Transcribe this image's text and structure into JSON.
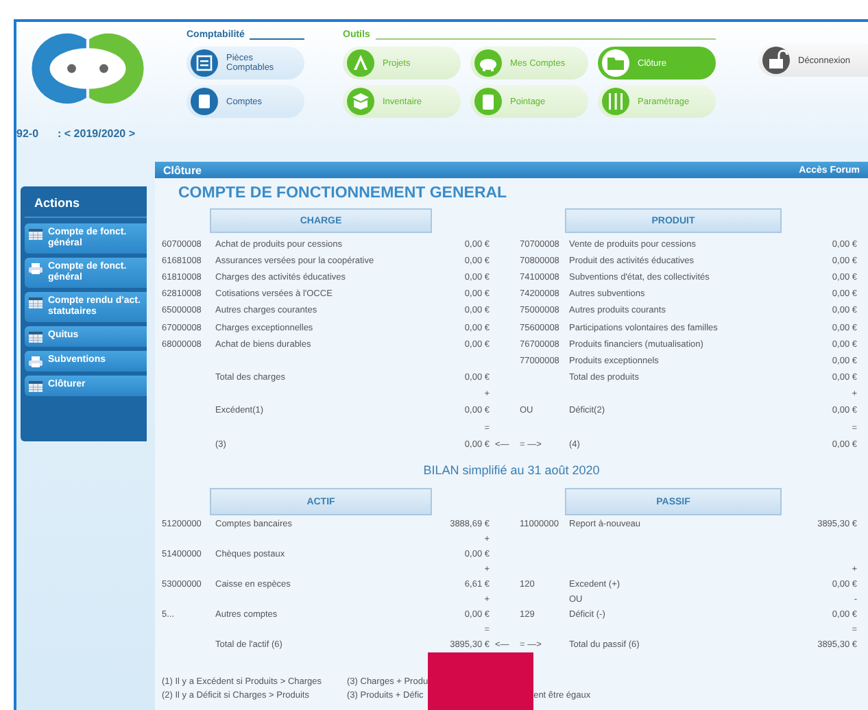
{
  "school": {
    "code": "92-0",
    "year": ": < 2019/2020 >"
  },
  "nav_groups": [
    {
      "title": "Comptabilité",
      "kind": "accounting",
      "items": [
        {
          "label": "Pièces Comptables",
          "selected": false
        },
        {
          "label": "Comptes",
          "selected": false
        }
      ]
    },
    {
      "title": "Outils",
      "kind": "tools",
      "items": [
        {
          "label": "Projets",
          "selected": false
        },
        {
          "label": "Mes Comptes",
          "selected": false
        },
        {
          "label": "Clôture",
          "selected": true
        },
        {
          "label": "Inventaire",
          "selected": false
        },
        {
          "label": "Pointage",
          "selected": false
        },
        {
          "label": "Paramètrage",
          "selected": false
        }
      ]
    }
  ],
  "logout_button": "Déconnexion",
  "sidebar": {
    "title": "Actions",
    "items": [
      {
        "label": "Compte de fonct. général",
        "kind": "table"
      },
      {
        "label": "Compte de fonct. général",
        "kind": "print"
      },
      {
        "label": "Compte rendu d'act. statutaires",
        "kind": "table"
      },
      {
        "label": "Quitus",
        "kind": "table"
      },
      {
        "label": "Subventions",
        "kind": "print"
      },
      {
        "label": "Clôturer",
        "kind": "table"
      }
    ]
  },
  "page_bar": {
    "title": "Clôture",
    "link": "Accès Forum"
  },
  "operating_account": {
    "title": "COMPTE DE FONCTIONNEMENT GENERAL",
    "headers": [
      "CHARGE",
      "PRODUIT"
    ],
    "rows": [
      {
        "left_code": "60700008",
        "left_label": "Achat de produits pour cessions",
        "left_amount": "0,00 €",
        "right_code": "70700008",
        "right_label": "Vente de produits pour cessions",
        "right_amount": "0,00 €"
      },
      {
        "left_code": "61681008",
        "left_label": "Assurances versées pour la coopérative",
        "left_amount": "0,00 €",
        "right_code": "70800008",
        "right_label": "Produit des activités éducatives",
        "right_amount": "0,00 €"
      },
      {
        "left_code": "61810008",
        "left_label": "Charges des activités éducatives",
        "left_amount": "0,00 €",
        "right_code": "74100008",
        "right_label": "Subventions d'état, des collectivités",
        "right_amount": "0,00 €"
      },
      {
        "left_code": "62810008",
        "left_label": "Cotisations versées à l'OCCE",
        "left_amount": "0,00 €",
        "right_code": "74200008",
        "right_label": "Autres subventions",
        "right_amount": "0,00 €"
      },
      {
        "left_code": "65000008",
        "left_label": "Autres charges courantes",
        "left_amount": "0,00 €",
        "right_code": "75000008",
        "right_label": "Autres produits courants",
        "right_amount": "0,00 €"
      },
      {
        "left_code": "67000008",
        "left_label": "Charges exceptionnelles",
        "left_amount": "0,00 €",
        "right_code": "75600008",
        "right_label": "Participations volontaires des familles",
        "right_amount": "0,00 €"
      },
      {
        "left_code": "68000008",
        "left_label": "Achat de biens durables",
        "left_amount": "0,00 €",
        "right_code": "76700008",
        "right_label": "Produits financiers (mutualisation)",
        "right_amount": "0,00 €"
      },
      {
        "right_code": "77000008",
        "right_label": "Produits exceptionnels",
        "right_amount": "0,00 €"
      },
      {
        "left_label": "Total des charges",
        "left_amount": "0,00 €",
        "right_label": "Total des produits",
        "right_amount": "0,00 €"
      },
      {
        "left_amount": "+",
        "right_amount": "+"
      },
      {
        "left_label": "Excédent(1)",
        "left_amount": "0,00 €",
        "right_code": "OU",
        "right_label": "Déficit(2)",
        "right_amount": "0,00 €"
      },
      {
        "left_amount": "=",
        "right_amount": "="
      },
      {
        "left_label": "(3)",
        "left_amount": "0,00 €",
        "arrow": "<—",
        "right_code": "= —>",
        "right_label": "(4)",
        "right_amount": "0,00 €"
      }
    ]
  },
  "balance_sheet": {
    "title": "BILAN simplifié au 31 août 2020",
    "headers": [
      "ACTIF",
      "PASSIF"
    ],
    "rows": [
      {
        "left_code": "51200000",
        "left_label": "Comptes bancaires",
        "left_amount": "3888,69 €",
        "right_code": "11000000",
        "right_label": "Report à-nouveau",
        "right_amount": "3895,30 €"
      },
      {
        "left_amount": "+"
      },
      {
        "left_code": "51400000",
        "left_label": "Chèques postaux",
        "left_amount": "0,00 €"
      },
      {
        "left_amount": "+",
        "right_amount": "+"
      },
      {
        "left_code": "53000000",
        "left_label": "Caisse en espèces",
        "left_amount": "6,61 €",
        "right_code": "120",
        "right_label": "Excedent (+)",
        "right_amount": "0,00 €"
      },
      {
        "left_amount": "+",
        "right_label": "OU",
        "right_amount": "-"
      },
      {
        "left_code": "5...",
        "left_label": "Autres comptes",
        "left_amount": "0,00 €",
        "right_code": "129",
        "right_label": "Déficit (-)",
        "right_amount": "0,00 €"
      },
      {
        "left_amount": "=",
        "right_amount": "="
      },
      {
        "left_label": "Total de l'actif (6)",
        "left_amount": "3895,30 €",
        "arrow": "<—",
        "right_code": "= —>",
        "right_label": "Total du passif (6)",
        "right_amount": "3895,30 €"
      }
    ]
  },
  "footnotes": [
    {
      "first": "(1) Il y a Excédent si Produits > Charges",
      "second": "(3) Charges + Produ"
    },
    {
      "first": "(2) Il y a Déficit si Charges > Produits",
      "second": "(3) Produits + Défic",
      "third": "ent être égaux"
    }
  ]
}
